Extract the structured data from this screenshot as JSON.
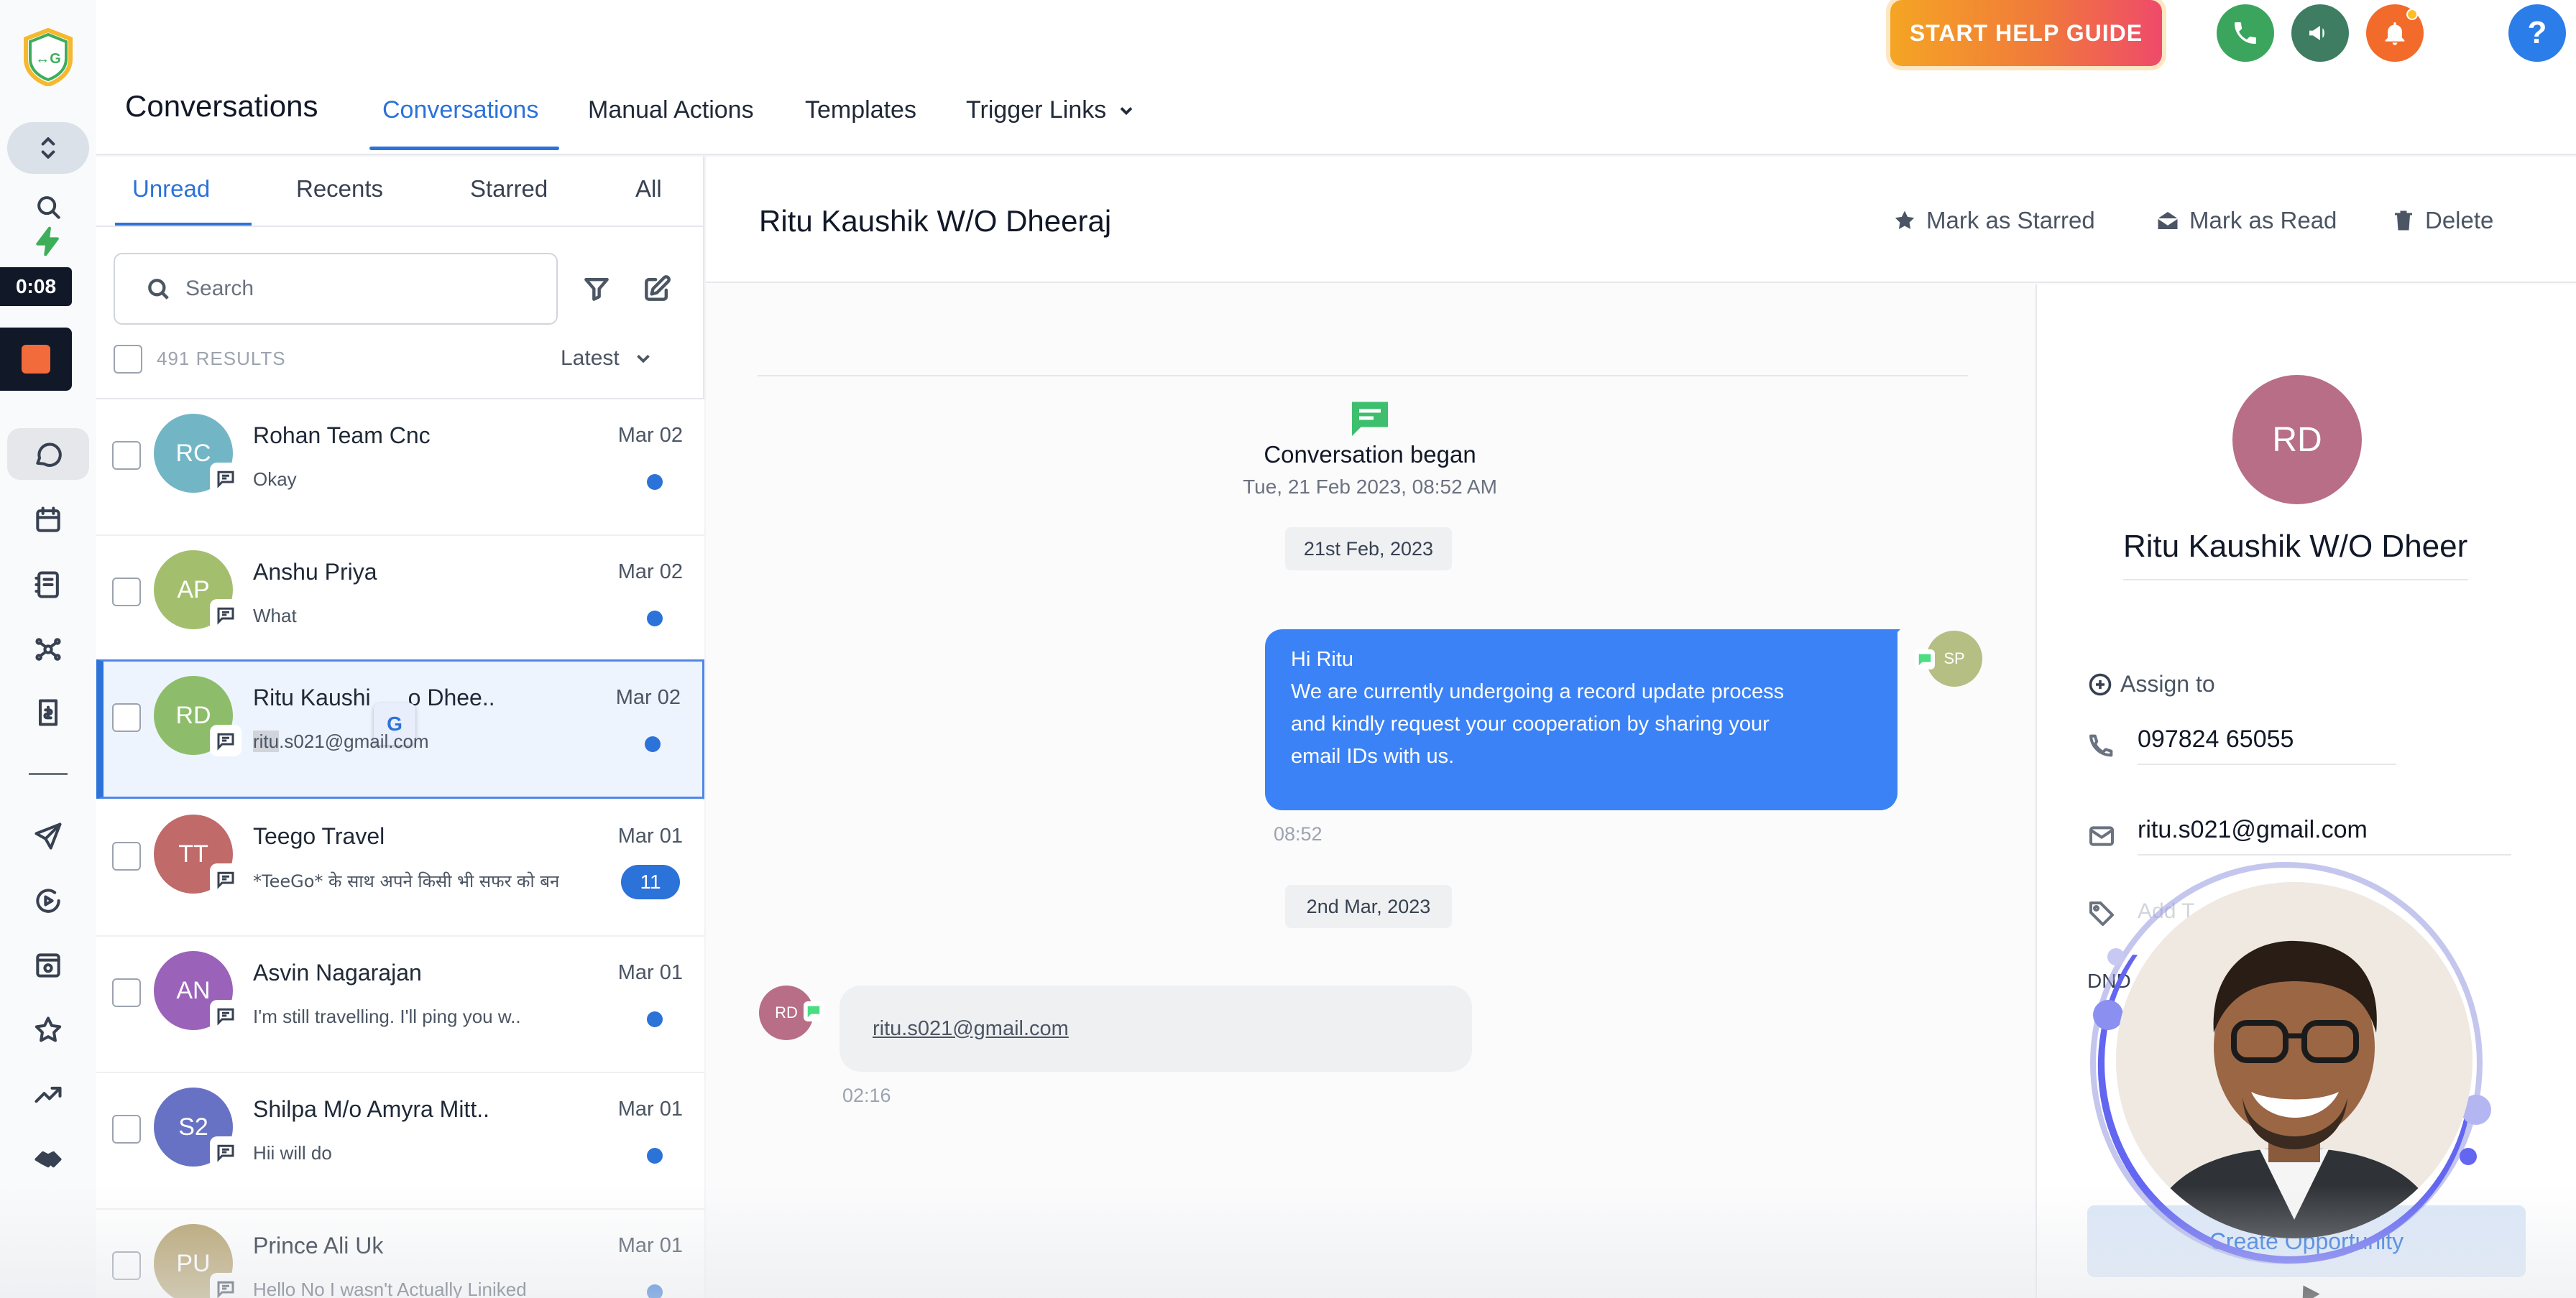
{
  "header": {
    "page_title": "Conversations",
    "tabs": [
      {
        "label": "Conversations",
        "active": true
      },
      {
        "label": "Manual Actions"
      },
      {
        "label": "Templates"
      },
      {
        "label": "Trigger Links"
      }
    ],
    "help_guide_label": "START HELP GUIDE",
    "icons": [
      "phone-icon",
      "megaphone-icon",
      "bell-icon",
      "help-icon",
      "brand-logo"
    ],
    "colors": {
      "phone": "#3ba55d",
      "megaphone": "#3e7d62",
      "bell": "#f26b2a",
      "help": "#2b7de9",
      "accent": "#2b72d9"
    }
  },
  "recording": {
    "timer": "0:08"
  },
  "list": {
    "tabs": [
      "Unread",
      "Recents",
      "Starred",
      "All"
    ],
    "active_tab": "Unread",
    "search_placeholder": "Search",
    "results_count": "491 RESULTS",
    "sort_label": "Latest",
    "conversations": [
      {
        "initials": "RC",
        "name": "Rohan Team Cnc",
        "preview": "Okay",
        "date": "Mar 02",
        "color": "#72b6c6",
        "unread_dot": true
      },
      {
        "initials": "AP",
        "name": "Anshu Priya",
        "preview": "What",
        "date": "Mar 02",
        "color": "#a3bf6e",
        "unread_dot": true
      },
      {
        "initials": "RD",
        "name_a": "Ritu Kaushi",
        "name_b": "o Dhee..",
        "preview_hl": "ritu",
        "preview_rest": ".s021@gmail.com",
        "date": "Mar 02",
        "color": "#8dbd6a",
        "unread_dot": true,
        "selected": true
      },
      {
        "initials": "TT",
        "name": "Teego Travel",
        "preview": "*TeeGo* के साथ अपने किसी भी सफर को बन",
        "date": "Mar 01",
        "color": "#c06a6a",
        "count": "11"
      },
      {
        "initials": "AN",
        "name": "Asvin Nagarajan",
        "preview": "I'm still travelling. I'll ping you w..",
        "date": "Mar 01",
        "color": "#9a62b8",
        "unread_dot": true
      },
      {
        "initials": "S2",
        "name": "Shilpa M/o Amyra Mitt..",
        "preview": "Hii will do",
        "date": "Mar 01",
        "color": "#6872c4",
        "unread_dot": true
      },
      {
        "initials": "PU",
        "name": "Prince Ali Uk",
        "preview": "Hello No I wasn't Actually Liniked",
        "date": "Mar 01",
        "color": "#b4a16c",
        "unread_dot": true
      }
    ]
  },
  "chat": {
    "title": "Ritu Kaushik W/O Dheeraj",
    "actions": {
      "star": "Mark as Starred",
      "read": "Mark as Read",
      "delete": "Delete"
    },
    "began_title": "Conversation began",
    "began_time": "Tue, 21 Feb 2023, 08:52 AM",
    "date_1": "21st Feb, 2023",
    "outgoing": {
      "lines": [
        "Hi Ritu",
        "We are currently undergoing a record update process",
        "and kindly request your cooperation by sharing your",
        "email IDs with us."
      ],
      "time": "08:52",
      "avatar": "SP"
    },
    "date_2": "2nd Mar, 2023",
    "incoming": {
      "text": "ritu.s021@gmail.com",
      "time": "02:16",
      "avatar": "RD"
    }
  },
  "contact": {
    "initials": "RD",
    "name": "Ritu Kaushik W/O Dheeraj",
    "assign_label": "Assign to",
    "phone": "097824 65055",
    "email": "ritu.s021@gmail.com",
    "tags_placeholder": "Add T",
    "dnd_label": "DND",
    "opportunity_button": "Create Opportunity"
  }
}
